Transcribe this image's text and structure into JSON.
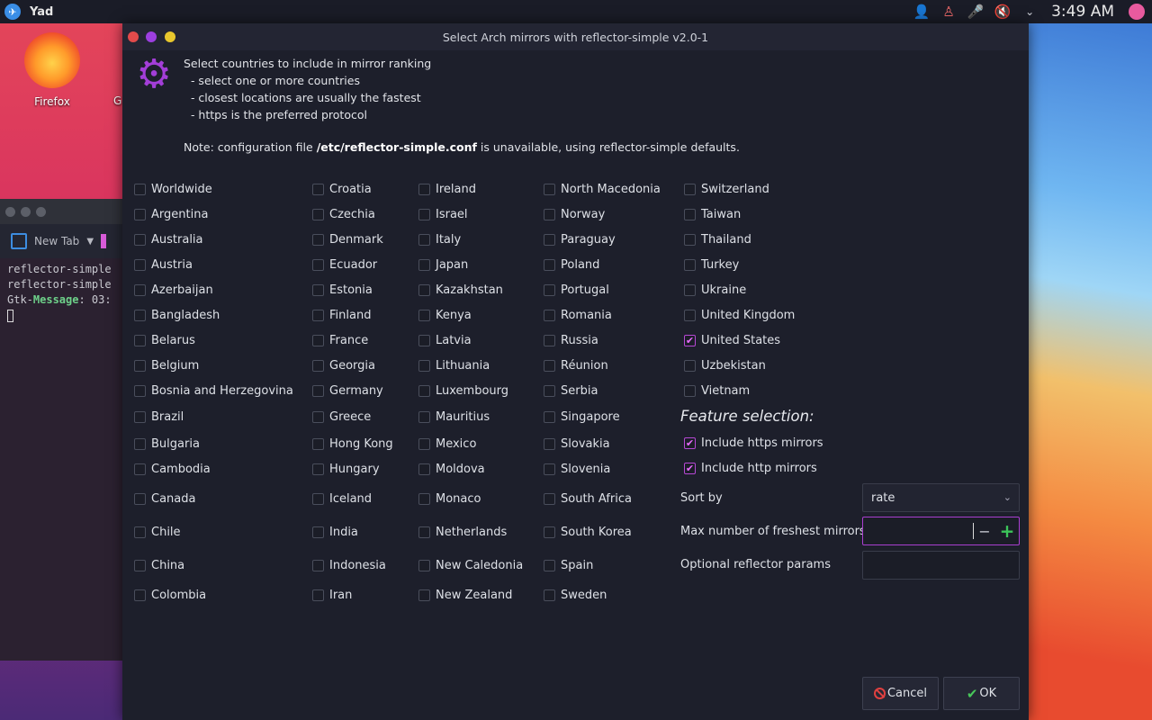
{
  "topbar": {
    "app_name": "Yad",
    "clock": "3:49 AM"
  },
  "desktop": {
    "firefox_label": "Firefox",
    "second_icon_label": "G"
  },
  "terminal": {
    "tab_label": "New Tab",
    "lines": [
      "reflector-simple",
      "reflector-simple"
    ],
    "gtk_prefix": "Gtk-",
    "gtk_keyword": "Message",
    "gtk_rest": ": 03:"
  },
  "dialog": {
    "title": "Select Arch mirrors with reflector-simple v2.0-1",
    "info_lines": [
      "Select countries to include in mirror ranking",
      "  - select one or more countries",
      "  - closest locations are usually the fastest",
      "  - https is the preferred protocol"
    ],
    "note_prefix": "Note: configuration file ",
    "note_file": "/etc/reflector-simple.conf",
    "note_suffix": " is unavailable, using reflector-simple defaults.",
    "countries": [
      [
        "Worldwide",
        "Argentina",
        "Australia",
        "Austria",
        "Azerbaijan",
        "Bangladesh",
        "Belarus",
        "Belgium",
        "Bosnia and Herzegovina",
        "Brazil",
        "Bulgaria",
        "Cambodia",
        "Canada",
        "Chile",
        "China",
        "Colombia"
      ],
      [
        "Croatia",
        "Czechia",
        "Denmark",
        "Ecuador",
        "Estonia",
        "Finland",
        "France",
        "Georgia",
        "Germany",
        "Greece",
        "Hong Kong",
        "Hungary",
        "Iceland",
        "India",
        "Indonesia",
        "Iran"
      ],
      [
        "Ireland",
        "Israel",
        "Italy",
        "Japan",
        "Kazakhstan",
        "Kenya",
        "Latvia",
        "Lithuania",
        "Luxembourg",
        "Mauritius",
        "Mexico",
        "Moldova",
        "Monaco",
        "Netherlands",
        "New Caledonia",
        "New Zealand"
      ],
      [
        "North Macedonia",
        "Norway",
        "Paraguay",
        "Poland",
        "Portugal",
        "Romania",
        "Russia",
        "Réunion",
        "Serbia",
        "Singapore",
        "Slovakia",
        "Slovenia",
        "South Africa",
        "South Korea",
        "Spain",
        "Sweden"
      ],
      [
        "Switzerland",
        "Taiwan",
        "Thailand",
        "Turkey",
        "Ukraine",
        "United Kingdom",
        "United States",
        "Uzbekistan",
        "Vietnam"
      ]
    ],
    "checked_country": "United States",
    "feature_title": "Feature selection:",
    "feature_https": "Include https mirrors",
    "feature_http": "Include http mirrors",
    "feature_https_checked": true,
    "feature_http_checked": true,
    "sort_label": "Sort by",
    "sort_value": "rate",
    "max_label": "Max number of freshest mirrors",
    "params_label": "Optional reflector params",
    "cancel_label": "Cancel",
    "ok_label": "OK"
  },
  "colors": {
    "accent": "#a93fd0",
    "gear": "#a33ed8",
    "plus": "#3cc45a",
    "cancel": "#e04040"
  }
}
